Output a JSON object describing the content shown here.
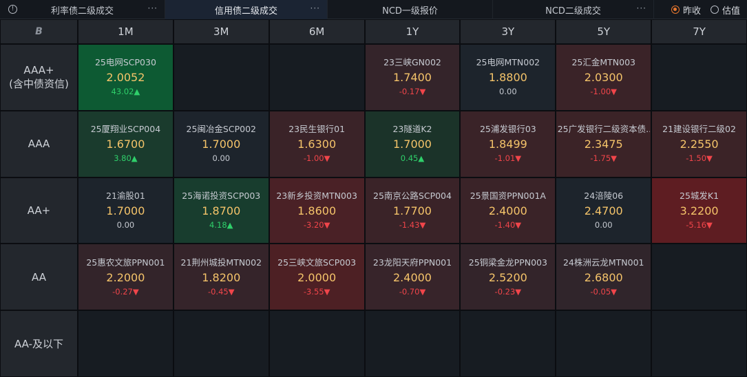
{
  "tabs": [
    {
      "label": "利率债二级成交",
      "more": "···"
    },
    {
      "label": "信用债二级成交",
      "more": "···"
    },
    {
      "label": "NCD一级报价",
      "more": ""
    },
    {
      "label": "NCD二级成交",
      "more": "···"
    }
  ],
  "radios": [
    {
      "label": "昨收",
      "selected": true
    },
    {
      "label": "估值",
      "selected": false
    }
  ],
  "corner_logo": "B",
  "columns": [
    "1M",
    "3M",
    "6M",
    "1Y",
    "3Y",
    "5Y",
    "7Y"
  ],
  "rows": [
    {
      "label_line1": "AAA+",
      "label_line2": "(含中债资信)",
      "cells": [
        {
          "bond": "25电网SCP030",
          "yield": "2.0052",
          "change": "43.02▲",
          "dir": "up",
          "bg": "#0d5a33"
        },
        null,
        null,
        {
          "bond": "23三峡GN002",
          "yield": "1.7400",
          "change": "-0.17▼",
          "dir": "dn",
          "bg": "#34242a"
        },
        {
          "bond": "25电网MTN002",
          "yield": "1.8800",
          "change": "0.00",
          "dir": "flat",
          "bg": "#1d242c"
        },
        {
          "bond": "25汇金MTN003",
          "yield": "2.0300",
          "change": "-1.00▼",
          "dir": "dn",
          "bg": "#3a2328"
        },
        null
      ]
    },
    {
      "label_line1": "AAA",
      "label_line2": "",
      "cells": [
        {
          "bond": "25厦翔业SCP004",
          "yield": "1.6700",
          "change": "3.80▲",
          "dir": "up",
          "bg": "#1a3b2d"
        },
        {
          "bond": "25闽冶金SCP002",
          "yield": "1.7000",
          "change": "0.00",
          "dir": "flat",
          "bg": "#1d242c"
        },
        {
          "bond": "23民生银行01",
          "yield": "1.6300",
          "change": "-1.00▼",
          "dir": "dn",
          "bg": "#3a2328"
        },
        {
          "bond": "23隧道K2",
          "yield": "1.7000",
          "change": "0.45▲",
          "dir": "up",
          "bg": "#1b3329"
        },
        {
          "bond": "25浦发银行03",
          "yield": "1.8499",
          "change": "-1.01▼",
          "dir": "dn",
          "bg": "#3a2328"
        },
        {
          "bond": "25广发银行二级资本债...",
          "yield": "2.3475",
          "change": "-1.75▼",
          "dir": "dn",
          "bg": "#3b2327"
        },
        {
          "bond": "21建设银行二级02",
          "yield": "2.2550",
          "change": "-1.50▼",
          "dir": "dn",
          "bg": "#3b2327"
        }
      ]
    },
    {
      "label_line1": "AA+",
      "label_line2": "",
      "cells": [
        {
          "bond": "21渝股01",
          "yield": "1.7000",
          "change": "0.00",
          "dir": "flat",
          "bg": "#1d242c"
        },
        {
          "bond": "25海诺投资SCP003",
          "yield": "1.8700",
          "change": "4.18▲",
          "dir": "up",
          "bg": "#183d2e"
        },
        {
          "bond": "23新乡投资MTN003",
          "yield": "1.8600",
          "change": "-3.20▼",
          "dir": "dn",
          "bg": "#4a2126"
        },
        {
          "bond": "25南京公路SCP004",
          "yield": "1.7700",
          "change": "-1.43▼",
          "dir": "dn",
          "bg": "#3a2328"
        },
        {
          "bond": "25景国资PPN001A",
          "yield": "2.4000",
          "change": "-1.40▼",
          "dir": "dn",
          "bg": "#3a2328"
        },
        {
          "bond": "24涪陵06",
          "yield": "2.4700",
          "change": "0.00",
          "dir": "flat",
          "bg": "#1d242c"
        },
        {
          "bond": "25城发K1",
          "yield": "3.2200",
          "change": "-5.16▼",
          "dir": "dn",
          "bg": "#5e1d22"
        }
      ]
    },
    {
      "label_line1": "AA",
      "label_line2": "",
      "cells": [
        {
          "bond": "25惠农文旅PPN001",
          "yield": "2.2000",
          "change": "-0.27▼",
          "dir": "dn",
          "bg": "#33242a"
        },
        {
          "bond": "21荆州城投MTN002",
          "yield": "1.8200",
          "change": "-0.45▼",
          "dir": "dn",
          "bg": "#35242a"
        },
        {
          "bond": "25三峡文旅SCP003",
          "yield": "2.0000",
          "change": "-3.55▼",
          "dir": "dn",
          "bg": "#4d2024"
        },
        {
          "bond": "23龙阳天府PPN001",
          "yield": "2.4000",
          "change": "-0.70▼",
          "dir": "dn",
          "bg": "#37242a"
        },
        {
          "bond": "25铜梁金龙PPN003",
          "yield": "2.5200",
          "change": "-0.23▼",
          "dir": "dn",
          "bg": "#33242a"
        },
        {
          "bond": "24株洲云龙MTN001",
          "yield": "2.6800",
          "change": "-0.05▼",
          "dir": "dn",
          "bg": "#30252b"
        },
        null
      ]
    },
    {
      "label_line1": "AA-及以下",
      "label_line2": "",
      "cells": [
        null,
        null,
        null,
        null,
        null,
        null,
        null
      ]
    }
  ]
}
